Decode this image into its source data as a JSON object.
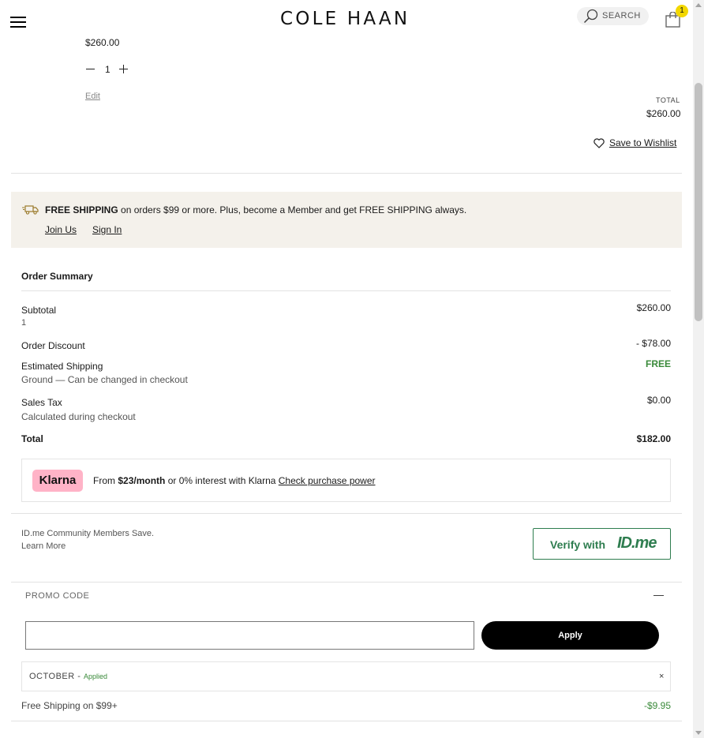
{
  "header": {
    "brand": "COLE HAAN",
    "search_label": "SEARCH",
    "bag_count": "1"
  },
  "cart_item": {
    "price": "$260.00",
    "quantity": "1",
    "edit_label": "Edit",
    "total_label": "TOTAL",
    "total_value": "$260.00",
    "wishlist_label": "Save to Wishlist"
  },
  "shipping_banner": {
    "headline_bold": "FREE SHIPPING",
    "headline_rest": " on orders $99 or more. Plus, become a Member and get FREE SHIPPING always.",
    "join_label": "Join Us",
    "signin_label": "Sign In"
  },
  "order_summary": {
    "title": "Order Summary",
    "subtotal_label": "Subtotal",
    "subtotal_count": "1",
    "subtotal_value": "$260.00",
    "discount_label": "Order Discount",
    "discount_value": "- $78.00",
    "shipping_label": "Estimated Shipping",
    "shipping_note": "Ground — Can be changed in checkout",
    "shipping_value": "FREE",
    "tax_label": "Sales Tax",
    "tax_note": "Calculated during checkout",
    "tax_value": "$0.00",
    "total_label": "Total",
    "total_value": "$182.00"
  },
  "klarna": {
    "badge": "Klarna",
    "prefix": "From ",
    "amount": "$23/month",
    "middle": " or 0% interest with Klarna ",
    "link": "Check purchase power"
  },
  "idme": {
    "line1": "ID.me Community Members Save.",
    "line2": "Learn More",
    "button_prefix": "Verify with",
    "button_brand": "ID.me"
  },
  "promo": {
    "title": "PROMO CODE",
    "toggle": "—",
    "input_value": "",
    "apply_label": "Apply",
    "applied_code": "OCTOBER",
    "applied_sep": " - ",
    "applied_status": "Applied",
    "remove_glyph": "×",
    "free_ship_label": "Free Shipping on $99+",
    "free_ship_value": "-$9.95"
  },
  "colors": {
    "accent_green": "#3a8a3a",
    "banner_bg": "#f4f1eb",
    "klarna_pink": "#ffb3c7",
    "badge_yellow": "#f2d700"
  }
}
